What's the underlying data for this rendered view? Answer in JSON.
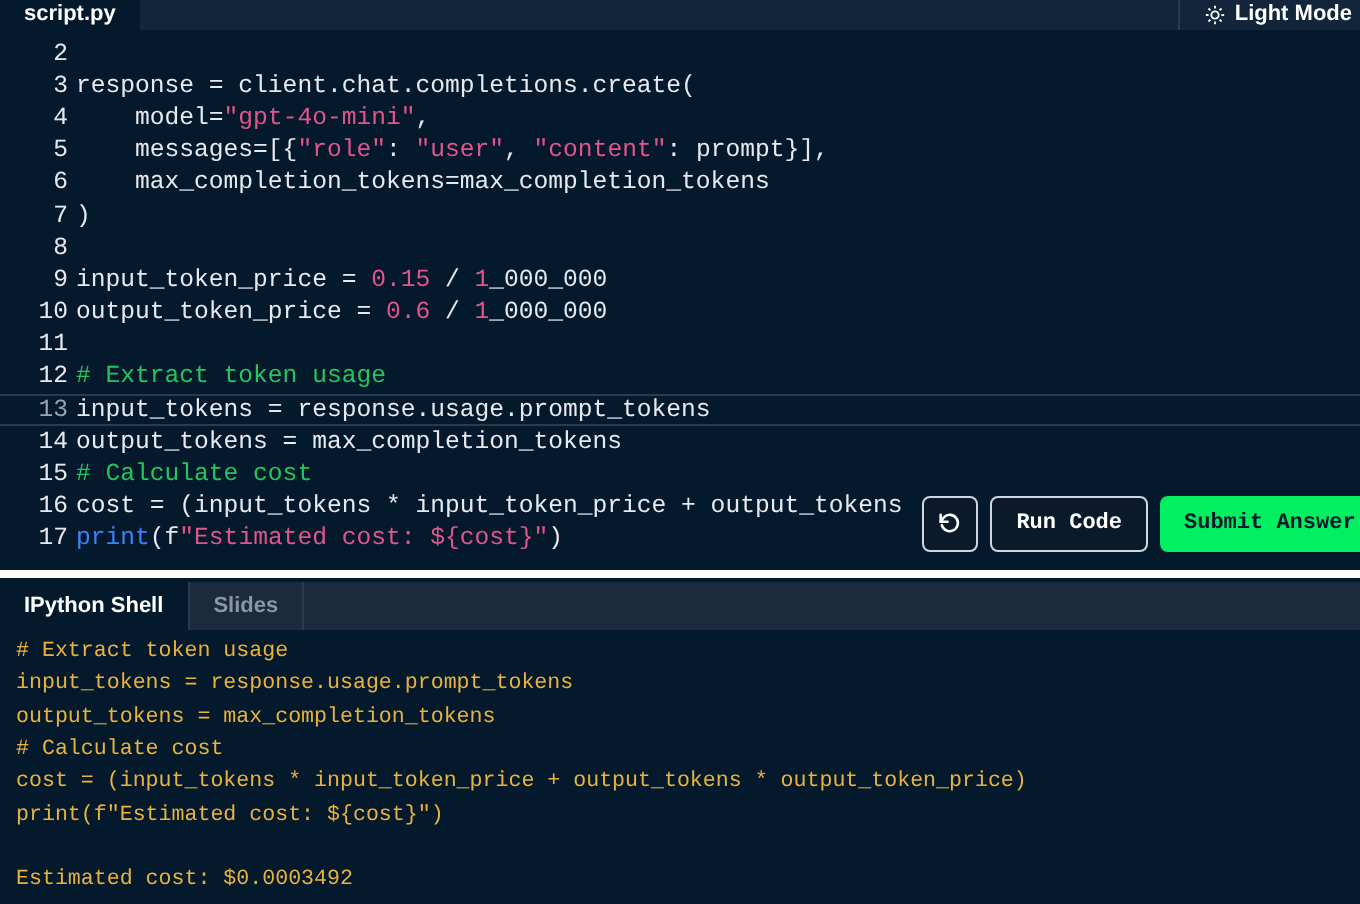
{
  "editor_tabs": [
    {
      "label": "script.py",
      "selected": true
    }
  ],
  "theme_toggle": {
    "label": "Light Mode"
  },
  "editor": {
    "lines": [
      {
        "number": "2",
        "current": false
      },
      {
        "number": "3",
        "current": false,
        "tokens": [
          {
            "text": "response = client.chat.completions.create(",
            "kind": "plain"
          }
        ]
      },
      {
        "number": "4",
        "current": false,
        "tokens": [
          {
            "text": "    model=",
            "kind": "plain"
          },
          {
            "text": "\"gpt-4o-mini\"",
            "kind": "string"
          },
          {
            "text": ",",
            "kind": "plain"
          }
        ]
      },
      {
        "number": "5",
        "current": false,
        "tokens": [
          {
            "text": "    messages=[{",
            "kind": "plain"
          },
          {
            "text": "\"role\"",
            "kind": "string"
          },
          {
            "text": ": ",
            "kind": "plain"
          },
          {
            "text": "\"user\"",
            "kind": "string"
          },
          {
            "text": ", ",
            "kind": "plain"
          },
          {
            "text": "\"content\"",
            "kind": "string"
          },
          {
            "text": ": prompt}],",
            "kind": "plain"
          }
        ]
      },
      {
        "number": "6",
        "current": false,
        "tokens": [
          {
            "text": "    max_completion_tokens=max_completion_tokens",
            "kind": "plain"
          }
        ]
      },
      {
        "number": "7",
        "current": false,
        "tokens": [
          {
            "text": ")",
            "kind": "plain"
          }
        ]
      },
      {
        "number": "8",
        "current": false
      },
      {
        "number": "9",
        "current": false,
        "tokens": [
          {
            "text": "input_token_price = ",
            "kind": "plain"
          },
          {
            "text": "0.15",
            "kind": "number"
          },
          {
            "text": " / ",
            "kind": "plain"
          },
          {
            "text": "1",
            "kind": "number"
          },
          {
            "text": "_000_000",
            "kind": "plain"
          }
        ]
      },
      {
        "number": "10",
        "current": false,
        "tokens": [
          {
            "text": "output_token_price = ",
            "kind": "plain"
          },
          {
            "text": "0.6",
            "kind": "number"
          },
          {
            "text": " / ",
            "kind": "plain"
          },
          {
            "text": "1",
            "kind": "number"
          },
          {
            "text": "_000_000",
            "kind": "plain"
          }
        ]
      },
      {
        "number": "11",
        "current": false
      },
      {
        "number": "12",
        "current": false,
        "tokens": [
          {
            "text": "# Extract token usage",
            "kind": "comment"
          }
        ]
      },
      {
        "number": "13",
        "current": true,
        "tokens": [
          {
            "text": "input_tokens = response.usage.prompt_tokens",
            "kind": "plain"
          }
        ]
      },
      {
        "number": "14",
        "current": false,
        "tokens": [
          {
            "text": "output_tokens = max_completion_tokens",
            "kind": "plain"
          }
        ]
      },
      {
        "number": "15",
        "current": false,
        "tokens": [
          {
            "text": "# Calculate cost",
            "kind": "comment"
          }
        ]
      },
      {
        "number": "16",
        "current": false,
        "tokens": [
          {
            "text": "cost = (input_tokens * input_token_price + output_tokens",
            "kind": "plain"
          }
        ]
      },
      {
        "number": "17",
        "current": false,
        "tokens": [
          {
            "text": "print",
            "kind": "keyword"
          },
          {
            "text": "(f",
            "kind": "plain"
          },
          {
            "text": "\"Estimated cost: ${cost}\"",
            "kind": "string"
          },
          {
            "text": ")",
            "kind": "plain"
          }
        ]
      }
    ]
  },
  "actions": [
    {
      "kind": "reset"
    },
    {
      "kind": "secondary",
      "label": "Run Code"
    },
    {
      "kind": "primary",
      "label": "Submit Answer"
    }
  ],
  "shell_tabs": [
    {
      "label": "IPython Shell",
      "selected": true
    },
    {
      "label": "Slides",
      "selected": false
    }
  ],
  "shell_output": [
    {
      "text": "# Extract token usage",
      "kind": "echo"
    },
    {
      "text": "input_tokens = response.usage.prompt_tokens",
      "kind": "echo"
    },
    {
      "text": "output_tokens = max_completion_tokens",
      "kind": "echo"
    },
    {
      "text": "# Calculate cost",
      "kind": "echo"
    },
    {
      "text": "cost = (input_tokens * input_token_price + output_tokens * output_token_price)",
      "kind": "echo"
    },
    {
      "text": "print(f\"Estimated cost: ${cost}\")",
      "kind": "echo"
    },
    {
      "text": "Estimated cost: $0.0003492",
      "kind": "result"
    }
  ]
}
